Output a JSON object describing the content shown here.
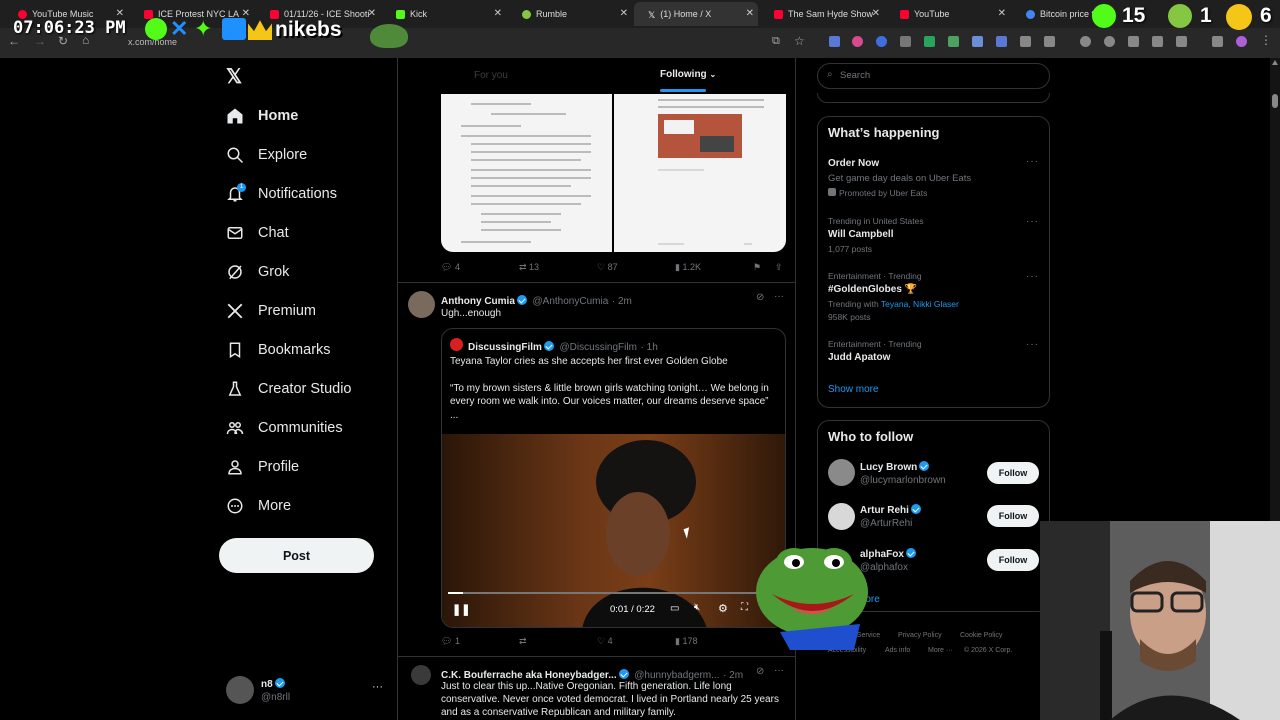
{
  "browser": {
    "tabs": [
      {
        "label": "YouTube Music",
        "color": "#ff0033"
      },
      {
        "label": "ICE Protest NYC LA",
        "color": "#ff0033"
      },
      {
        "label": "01/11/26 - ICE Shooti",
        "color": "#ff0033"
      },
      {
        "label": "Kick",
        "color": "#53fc18"
      },
      {
        "label": "Rumble",
        "color": "#85c742"
      },
      {
        "label": "(1) Home / X",
        "color": "#ffffff"
      },
      {
        "label": "The Sam Hyde Show",
        "color": "#ff0033"
      },
      {
        "label": "YouTube",
        "color": "#ff0033"
      },
      {
        "label": "Bitcoin price tod",
        "color": "#4285f4"
      }
    ],
    "url": "x.com/home"
  },
  "overlay": {
    "clock": "07:06:23 PM",
    "nick": "nikebs",
    "counter_a": "15",
    "counter_b": "1",
    "counter_c": "6"
  },
  "sidebar": {
    "items": [
      {
        "label": "Home",
        "icon": "home-icon"
      },
      {
        "label": "Explore",
        "icon": "search-icon"
      },
      {
        "label": "Notifications",
        "icon": "bell-icon"
      },
      {
        "label": "Chat",
        "icon": "mail-icon"
      },
      {
        "label": "Grok",
        "icon": "grok-icon"
      },
      {
        "label": "Premium",
        "icon": "x-icon"
      },
      {
        "label": "Bookmarks",
        "icon": "bookmark-icon"
      },
      {
        "label": "Creator Studio",
        "icon": "flask-icon"
      },
      {
        "label": "Communities",
        "icon": "communities-icon"
      },
      {
        "label": "Profile",
        "icon": "person-icon"
      },
      {
        "label": "More",
        "icon": "more-icon"
      }
    ],
    "notification_badge": "1",
    "post_label": "Post",
    "user": {
      "name": "n8",
      "handle": "@n8rll"
    }
  },
  "feed": {
    "tab_for_you": "For you",
    "tab_following": "Following",
    "tweet1_actions": {
      "replies": "4",
      "reposts": "13",
      "likes": "87",
      "views": "1.2K"
    },
    "tweet2": {
      "name": "Anthony Cumia",
      "handle": "@AnthonyCumia",
      "time": "· 2m",
      "text": "Ugh...enough",
      "quote": {
        "name": "DiscussingFilm",
        "handle": "@DiscussingFilm",
        "time": "· 1h",
        "line1": "Teyana Taylor cries as she accepts her first ever Golden Globe",
        "line2": "“To my brown sisters & little brown girls watching tonight… We belong in every room we walk into. Our voices matter, our dreams deserve space”",
        "line3": "...",
        "video_time": "0:01 / 0:22",
        "progress": 0.045
      },
      "actions": {
        "replies": "1",
        "reposts": "",
        "likes": "4",
        "views": "178"
      }
    },
    "tweet3": {
      "name": "C.K. Bouferrache aka Honeybadger...",
      "handle": "@hunnybadgerm...",
      "time": "· 2m",
      "text": "Just to clear this up...Native Oregonian. Fifth generation. Life long conservative. Never once voted democrat. I lived in Portland nearly 25 years and as a conservative Republican and military family."
    }
  },
  "right": {
    "search_placeholder": "Search",
    "happening_title": "What’s happening",
    "trends": [
      {
        "small": "",
        "big": "Order Now",
        "sub": "Get game day deals on Uber Eats",
        "sub2": "Promoted by Uber Eats"
      },
      {
        "small": "Trending in United States",
        "big": "Will Campbell",
        "sub": "1,077 posts"
      },
      {
        "small": "Entertainment · Trending",
        "big": "#GoldenGlobes 🏆",
        "sub_prefix": "Trending with ",
        "sub_link": "Teyana, Nikki Glaser",
        "sub2": "958K posts"
      },
      {
        "small": "Entertainment · Trending",
        "big": "Judd Apatow"
      }
    ],
    "show_more": "Show more",
    "who_title": "Who to follow",
    "follows": [
      {
        "name": "Lucy Brown",
        "handle": "@lucymarlonbrown",
        "btn": "Follow"
      },
      {
        "name": "Artur Rehi",
        "handle": "@ArturRehi",
        "btn": "Follow"
      },
      {
        "name": "alphaFox",
        "handle": "@alphafox",
        "btn": "Follow"
      }
    ],
    "who_more": "more",
    "footer": [
      "Terms of Service",
      "Privacy Policy",
      "Cookie Policy",
      "Accessibility",
      "Ads info",
      "More ···",
      "© 2026 X Corp."
    ]
  }
}
